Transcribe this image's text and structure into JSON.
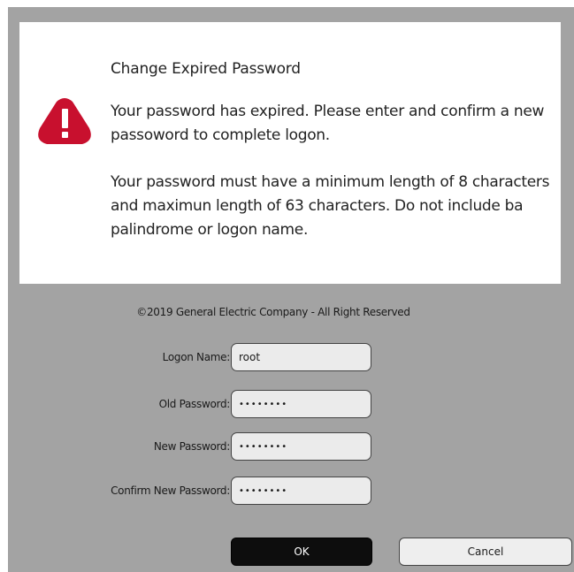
{
  "dialog": {
    "title": "Change Expired Password",
    "message": "Your password has expired. Please enter and confirm a new passoword to complete logon.",
    "requirements": "Your password must have a minimum length of 8 characters and maximun length of 63 characters. Do not include ba palindrome or logon name.",
    "icon": "warning-icon",
    "icon_color": "#c8102e"
  },
  "copyright": "©2019 General Electric Company - All Right Reserved",
  "form": {
    "logon_name": {
      "label": "Logon Name:",
      "value": "root"
    },
    "old_password": {
      "label": "Old Password:",
      "value": "••••••••"
    },
    "new_password": {
      "label": "New Password:",
      "value": "••••••••"
    },
    "confirm_password": {
      "label": "Confirm New Password:",
      "value": "••••••••"
    }
  },
  "buttons": {
    "ok": "OK",
    "cancel": "Cancel"
  }
}
